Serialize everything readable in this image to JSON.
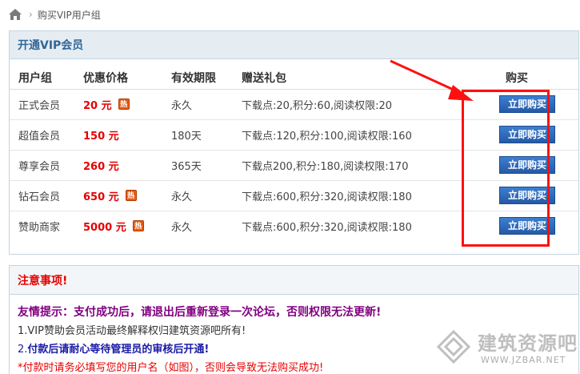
{
  "breadcrumb": {
    "home_icon": "home-icon",
    "separator": "›",
    "current": "购买VIP用户组"
  },
  "vip_panel": {
    "title": "开通VIP会员",
    "headers": {
      "group": "用户组",
      "price": "优惠价格",
      "period": "有效期限",
      "gift": "赠送礼包",
      "buy": "购买"
    },
    "rows": [
      {
        "group": "正式会员",
        "price": "20 元",
        "hot": true,
        "period": "永久",
        "gift": "下载点:20,积分:60,阅读权限:20",
        "buy_label": "立即购买"
      },
      {
        "group": "超值会员",
        "price": "150 元",
        "hot": false,
        "period": "180天",
        "gift": "下载点:120,积分:100,阅读权限:160",
        "buy_label": "立即购买"
      },
      {
        "group": "尊享会员",
        "price": "260 元",
        "hot": false,
        "period": "365天",
        "gift": "下载点200,积分:180,阅读权限:170",
        "buy_label": "立即购买"
      },
      {
        "group": "钻石会员",
        "price": "650 元",
        "hot": true,
        "period": "永久",
        "gift": "下载点:600,积分:320,阅读权限:180",
        "buy_label": "立即购买"
      },
      {
        "group": "赞助商家",
        "price": "5000 元",
        "hot": true,
        "period": "永久",
        "gift": "下载点:600,积分:320,阅读权限:180",
        "buy_label": "立即购买"
      }
    ],
    "hot_label": "热"
  },
  "notice": {
    "title": "注意事项!",
    "tip": "友情提示：支付成功后，请退出后重新登录一次论坛，否则权限无法更新!",
    "line1": "1.VIP赞助会员活动最终解释权归建筑资源吧所有!",
    "line2_num": "2.",
    "line2_text": "付款后请耐心等待管理员的审核后开通!",
    "line3": "*付款时请务必填写您的用户名（如图），否则会导致无法购买成功!"
  },
  "watermark": {
    "title": "建筑资源吧",
    "url": "WWW.JZBAR.NET"
  },
  "colors": {
    "panel_border": "#c2d5e3",
    "panel_head_bg": "#e5edf2",
    "title_blue": "#336699",
    "price_red": "#e60000",
    "button_blue": "#2e66b8",
    "annotation_red": "#ff1010",
    "tip_purple": "#800080"
  }
}
